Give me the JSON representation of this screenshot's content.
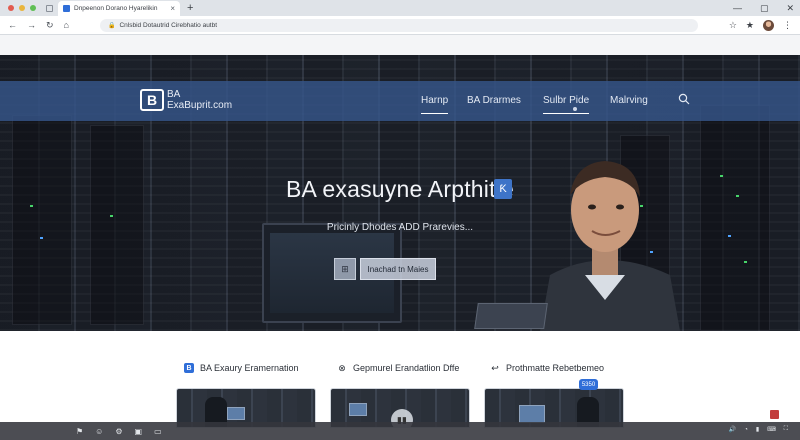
{
  "browser": {
    "tab_title": "Dnpeenon Dorano Hyarelikin",
    "new_tab_symbol": "+",
    "tab_close_symbol": "×",
    "url": "Cnlsbid Dotautrid Cirebhatio  autbt",
    "window_controls": [
      "—",
      "▢",
      "✕"
    ]
  },
  "site": {
    "logo_letter": "B",
    "brand_line1": "BA",
    "brand_line2": "ExaBuprit.com",
    "nav": {
      "home": "Harnp",
      "domains": "BA Drarmes",
      "side": "Sulbr Pide",
      "marketing": "Malrving"
    }
  },
  "hero": {
    "title": "BA exasuyne Arpthitie",
    "title_badge": "Ƙ",
    "subtitle": "Pricinly Dhodes ADD Prarevies...",
    "cta_label": "Inachad tn Maies",
    "cta_icon": "⊞"
  },
  "features": {
    "items": [
      {
        "label": "BA Exaury Eramernation",
        "icon": "B"
      },
      {
        "label": "Gepmurel Erandatlion Dffe",
        "icon": "⊗"
      },
      {
        "label": "Prothmatte Rebetbemeo",
        "icon": "↩"
      }
    ],
    "card_badge": "5350"
  },
  "colors": {
    "nav_bar": "#36568a",
    "accent": "#2f6ed8",
    "hero_dark": "#20252e"
  }
}
